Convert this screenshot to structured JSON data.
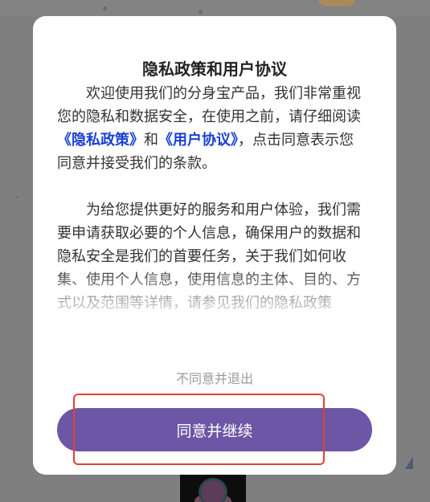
{
  "dialog": {
    "title": "隐私政策和用户协议",
    "paragraph1": {
      "before": "欢迎使用我们的分身宝产品，我们非常重视您的隐私和数据安全，在使用之前，请仔细阅读",
      "privacy_link": "《隐私政策》",
      "middle": "和",
      "user_link": "《用户协议》",
      "after": "，点击同意表示您同意并接受我们的条款。"
    },
    "paragraph2": "为给您提供更好的服务和用户体验，我们需要申请获取必要的个人信息，确保用户的数据和隐私安全是我们的首要任务，关于我们如何收集、使用个人信息，使用信息的主体、目的、方式以及范围等详情，请参见我们的隐私政策",
    "disagree_label": "不同意并退出",
    "agree_label": "同意并继续"
  },
  "colors": {
    "accent": "#6d56a6",
    "link": "#1a3fd4",
    "highlight": "#e0432f"
  }
}
